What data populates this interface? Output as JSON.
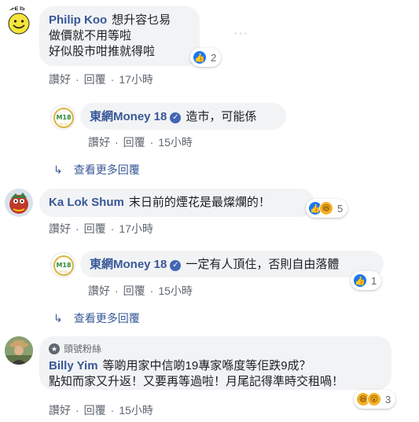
{
  "comments": [
    {
      "author": "Philip Koo",
      "avatar_badge_text": "LIFE IS",
      "text_lines": [
        "想升容乜易",
        "做價就不用等啦",
        "好似股市咁推就得啦"
      ],
      "reaction_count": "2",
      "actions": {
        "like": "讚好",
        "reply": "回覆",
        "time": "17小時"
      },
      "reply": {
        "author": "東網Money 18",
        "text": "造市，可能係",
        "actions": {
          "like": "讚好",
          "reply": "回覆",
          "time": "15小時"
        }
      },
      "more_replies": "查看更多回覆"
    },
    {
      "author": "Ka Lok Shum",
      "text": "末日前的煙花是最燦爛的！",
      "reaction_count": "5",
      "actions": {
        "like": "讚好",
        "reply": "回覆",
        "time": "17小時"
      },
      "reply": {
        "author": "東網Money 18",
        "text": "一定有人頂住，否則自由落體",
        "reaction_count": "1",
        "actions": {
          "like": "讚好",
          "reply": "回覆",
          "time": "15小時"
        }
      },
      "more_replies": "查看更多回覆"
    },
    {
      "badge": "頭號粉絲",
      "author": "Billy Yim",
      "text_line1": "等啲用家中信啲19專家喺度等佢跌9成？",
      "text_line2": "點知而家又升返！又要再等過啦！月尾記得準時交租喎！",
      "reaction_count": "3",
      "actions": {
        "like": "讚好",
        "reply": "回覆",
        "time": "15小時"
      }
    }
  ],
  "separator": "·",
  "colors": {
    "link": "#385898",
    "bubble": "#f2f3f5",
    "meta": "#606770",
    "like": "#1877f2"
  }
}
